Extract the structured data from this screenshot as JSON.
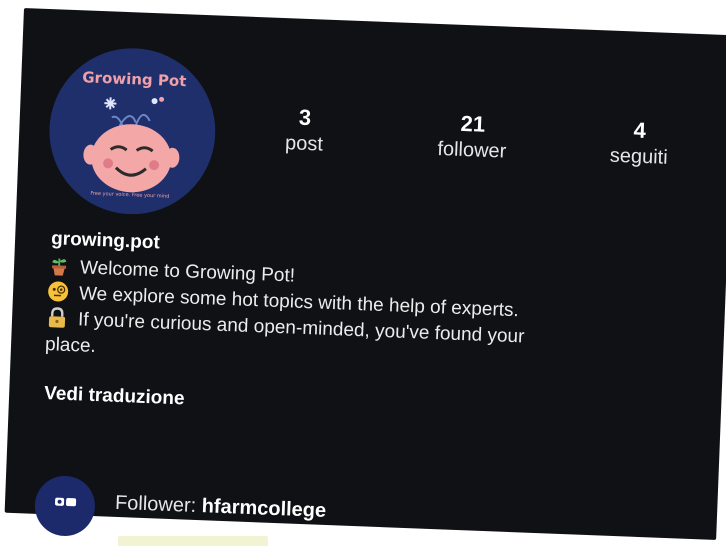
{
  "profile": {
    "avatar": {
      "logo_text": "Growing Pot",
      "tagline": "Free your voice. Free your mind",
      "bg_color": "#1f2f6b",
      "text_color": "#f0a0a8"
    },
    "stats": {
      "posts": {
        "value": "3",
        "label": "post"
      },
      "followers": {
        "value": "21",
        "label": "follower"
      },
      "following": {
        "value": "4",
        "label": "seguiti"
      }
    },
    "username": "growing.pot",
    "bio": [
      {
        "icon": "potted-plant-icon",
        "text": "Welcome to Growing Pot!"
      },
      {
        "icon": "face-with-monocle-icon",
        "text": "We explore some hot topics with the help of experts."
      },
      {
        "icon": "lock-icon",
        "text": "If you're curious and open-minded, you've found your"
      },
      {
        "icon": "",
        "text": "place."
      }
    ],
    "translate_label": "Vedi traduzione",
    "followed_by": {
      "prefix": "Follower:",
      "account": "hfarmcollege",
      "avatar_color": "#1c2a6c"
    }
  }
}
